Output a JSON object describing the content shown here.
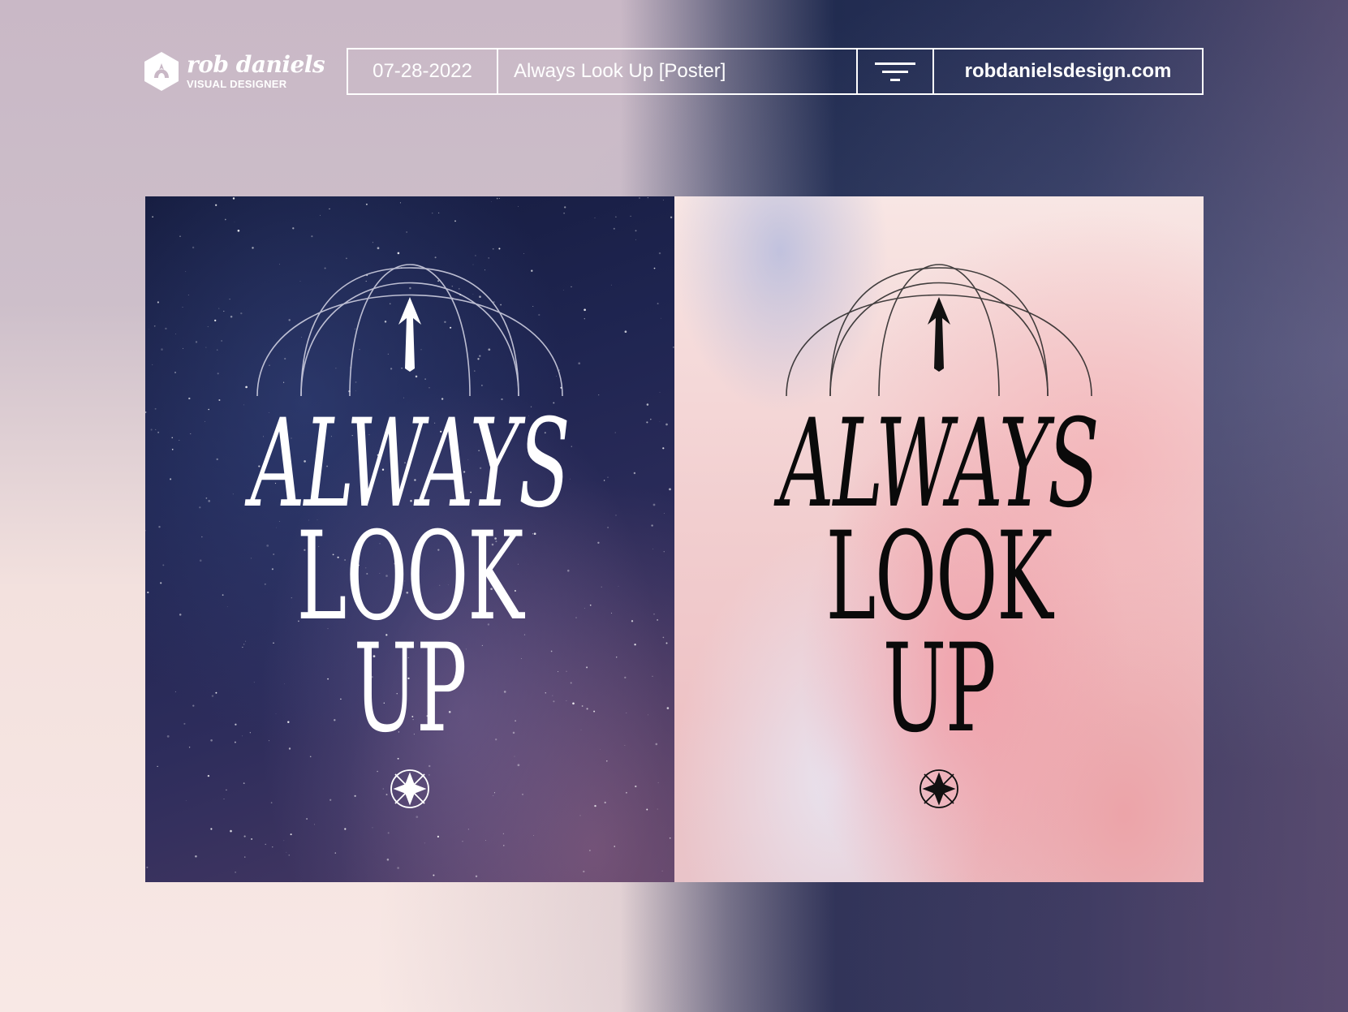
{
  "brand": {
    "name": "rob daniels",
    "subtitle": "VISUAL DESIGNER"
  },
  "header": {
    "date": "07-28-2022",
    "title": "Always Look Up [Poster]",
    "filter_icon": "filter-icon",
    "url": "robdanielsdesign.com"
  },
  "posters": [
    {
      "theme": "night-sky",
      "line1": "ALWAYS",
      "line2": "LOOK",
      "line3": "UP",
      "text_color": "#ffffff",
      "art_color": "#ffffff"
    },
    {
      "theme": "pink-clouds",
      "line1": "ALWAYS",
      "line2": "LOOK",
      "line3": "UP",
      "text_color": "#0a0a0a",
      "art_color": "#111111"
    }
  ],
  "colors": {
    "accent": "#ffffff",
    "navy": "#1c2750",
    "blush": "#f6e4e0"
  }
}
